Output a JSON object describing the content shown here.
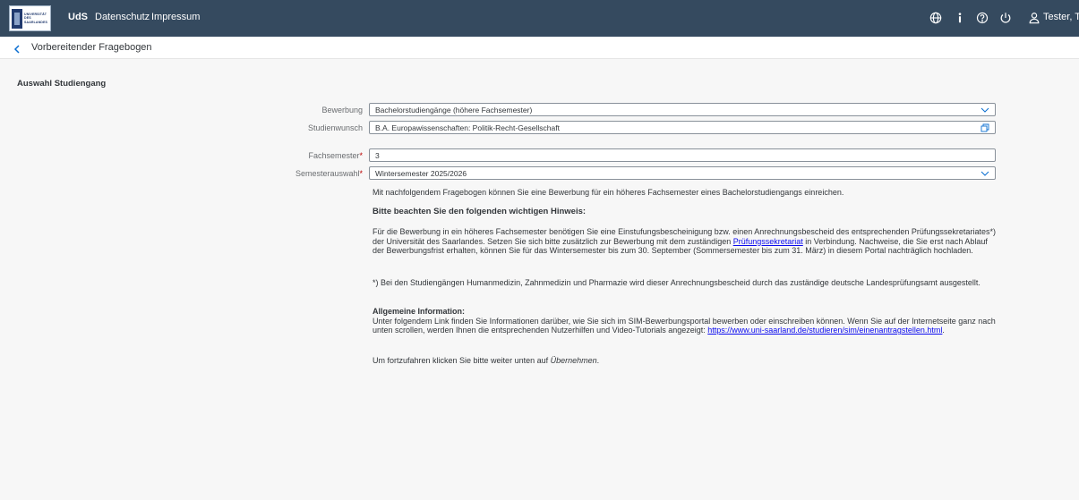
{
  "shell": {
    "logo_lines": [
      "UNIVERSITÄT",
      "DES",
      "SAARLANDES"
    ],
    "nav": [
      "UdS",
      "Datenschutz",
      "Impressum"
    ],
    "user": "Tester, Te"
  },
  "page": {
    "title": "Vorbereitender Fragebogen",
    "section_title": "Auswahl Studiengang"
  },
  "form": {
    "bewerbung_label": "Bewerbung",
    "bewerbung_value": "Bachelorstudiengänge (höhere Fachsemester)",
    "studienwunsch_label": "Studienwunsch",
    "studienwunsch_value": "B.A. Europawissenschaften: Politik-Recht-Gesellschaft",
    "fachsemester_label": "Fachsemester",
    "fachsemester_value": "3",
    "semesterauswahl_label": "Semesterauswahl",
    "semesterauswahl_value": "Wintersemester 2025/2026",
    "required_mark": "*"
  },
  "info": {
    "intro": "Mit nachfolgendem Fragebogen können Sie eine Bewerbung für ein höheres Fachsemester eines Bachelorstudiengangs einreichen.",
    "hint_heading": "Bitte beachten Sie den folgenden wichtigen Hinweis:",
    "p1_a": "Für die Bewerbung in ein höheres Fachsemester benötigen Sie eine Einstufungsbescheinigung bzw. einen Anrechnungsbescheid des entsprechenden Prüfungssekretariates*) der Universität des Saarlandes. Setzen Sie sich bitte zusätzlich zur Bewerbung mit dem zuständigen ",
    "p1_link": "Prüfungssekretariat",
    "p1_b": " in Verbindung. Nachweise, die Sie erst nach Ablauf der Bewerbungsfrist erhalten, können Sie für das Wintersemester bis zum 30. September (Sommersemester bis zum 31. März) in diesem Portal nachträglich hochladen.",
    "p2": "*) Bei den Studiengängen Humanmedizin, Zahnmedizin und Pharmazie wird dieser Anrechnungsbescheid durch das zuständige deutsche Landesprüfungsamt ausgestellt.",
    "general_heading": "Allgemeine Information:",
    "p3_a": "Unter folgendem Link finden Sie Informationen darüber, wie Sie sich im SIM-Bewerbungsportal bewerben oder einschreiben können. Wenn Sie auf der Internetseite ganz nach unten scrollen, werden Ihnen die entsprechenden Nutzerhilfen und Video-Tutorials angezeigt: ",
    "p3_link": "https://www.uni-saarland.de/studieren/sim/einenantragstellen.html",
    "p3_b": ".",
    "p4_a": "Um fortzufahren klicken Sie bitte weiter unten auf ",
    "p4_em": "Übernehmen",
    "p4_b": "."
  }
}
